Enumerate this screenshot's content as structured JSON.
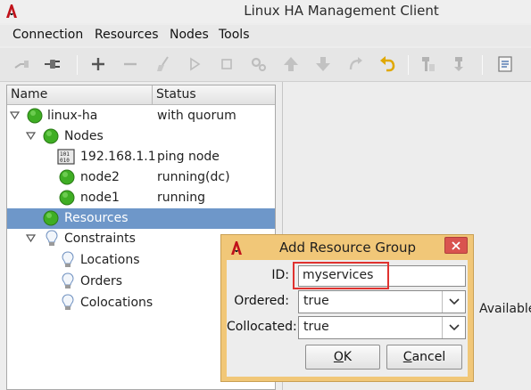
{
  "window": {
    "title": "Linux HA Management Client"
  },
  "menu": [
    {
      "label": "Connection"
    },
    {
      "label": "Resources"
    },
    {
      "label": "Nodes"
    },
    {
      "label": "Tools"
    }
  ],
  "toolbar": {
    "icons": [
      "disconnect-icon",
      "connect-icon",
      "add-icon",
      "remove-icon",
      "cleanup-broom-icon",
      "start-play-icon",
      "stop-icon",
      "manage-gear-icon",
      "move-up-icon",
      "move-down-icon",
      "migrate-icon",
      "undo-icon",
      "standby-icon",
      "active-icon",
      "document-icon"
    ]
  },
  "tree": {
    "columns": {
      "name": "Name",
      "status": "Status"
    },
    "rows": [
      {
        "label": "linux-ha",
        "status": "with quorum"
      },
      {
        "label": "Nodes",
        "status": ""
      },
      {
        "label": "192.168.1.1",
        "status": "ping node"
      },
      {
        "label": "node2",
        "status": "running(dc)"
      },
      {
        "label": "node1",
        "status": "running"
      },
      {
        "label": "Resources",
        "status": ""
      },
      {
        "label": "Constraints",
        "status": ""
      },
      {
        "label": "Locations",
        "status": ""
      },
      {
        "label": "Orders",
        "status": ""
      },
      {
        "label": "Colocations",
        "status": ""
      }
    ]
  },
  "right_panel": {
    "available_text": "Available"
  },
  "dialog": {
    "title": "Add Resource Group",
    "fields": {
      "id_label": "ID:",
      "id_value": "myservices",
      "ordered_label": "Ordered:",
      "ordered_value": "true",
      "collocated_label": "Collocated:",
      "collocated_value": "true"
    },
    "buttons": {
      "ok_mnemonic": "O",
      "ok_rest": "K",
      "cancel_mnemonic": "C",
      "cancel_rest": "ancel"
    }
  },
  "colors": {
    "selection": "#6e97c9",
    "dialog_frame": "#f1c778",
    "highlight_box": "#e0322f",
    "status_ok": "#3fae24"
  }
}
